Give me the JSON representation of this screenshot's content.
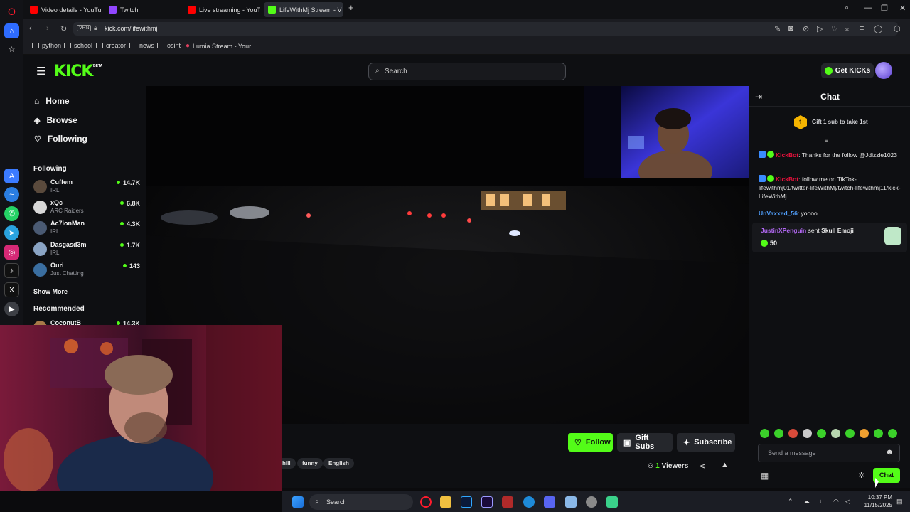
{
  "browser": {
    "tabs": [
      {
        "title": "Video details - YouTube S",
        "color": "#ff0000"
      },
      {
        "title": "Twitch",
        "color": "#9146ff"
      },
      {
        "title": "Live streaming - YouTube",
        "color": "#ff0000"
      },
      {
        "title": "LifeWithMj Stream - V",
        "color": "#53fc18"
      }
    ],
    "vpn_label": "VPN",
    "url": "kick.com/lifewithmj",
    "bookmarks": [
      "python",
      "school",
      "creator",
      "news",
      "osint",
      "Lumia Stream - Your..."
    ]
  },
  "header": {
    "logo": "KICK",
    "beta": "BETA",
    "search_placeholder": "Search",
    "get_kicks": "Get KICKs"
  },
  "sidebar": {
    "nav": [
      {
        "label": "Home",
        "icon": "home-icon"
      },
      {
        "label": "Browse",
        "icon": "compass-icon"
      },
      {
        "label": "Following",
        "icon": "heart-icon"
      }
    ],
    "following_title": "Following",
    "channels": [
      {
        "name": "Cuffem",
        "category": "IRL",
        "viewers": "14.7K",
        "color": "#5a4a3c"
      },
      {
        "name": "xQc",
        "category": "ARC Raiders",
        "viewers": "6.8K",
        "color": "#d8d8d8"
      },
      {
        "name": "Ac7ionMan",
        "category": "IRL",
        "viewers": "4.3K",
        "color": "#4a5a73"
      },
      {
        "name": "Dasgasd3m",
        "category": "IRL",
        "viewers": "1.7K",
        "color": "#8aa4c4"
      },
      {
        "name": "Ouri",
        "category": "Just Chatting",
        "viewers": "143",
        "color": "#3a6ea0"
      }
    ],
    "show_more": "Show More",
    "recommended_title": "Recommended",
    "recommended": [
      {
        "name": "CoconutB",
        "viewers": "14.3K"
      }
    ]
  },
  "stream": {
    "follow_label": "Follow",
    "gift_subs_label": "Gift Subs",
    "subscribe_label": "Subscribe",
    "tags": [
      "hill",
      "funny",
      "English"
    ],
    "viewers_count": "1",
    "viewers_label": "Viewers"
  },
  "chat": {
    "title": "Chat",
    "gift_rank": "1",
    "gift_prompt": "Gift 1 sub to take 1st",
    "messages": [
      {
        "user": "KickBot",
        "text": ": Thanks for the follow @Jdizzle1023"
      },
      {
        "user": "KickBot",
        "text": ": follow me on TikTok-lifewithmj01/twitter-lifeWithMj/twitch-lifewithmj11/kick-LifeWithMj"
      },
      {
        "user": "UnVaxxed_56",
        "text": ": yoooo"
      }
    ],
    "gift_event": {
      "user": "JustinXPenguin",
      "action": "sent",
      "item": "Skull Emoji",
      "amount": "50"
    },
    "input_placeholder": "Send a message",
    "send_label": "Chat"
  },
  "taskbar": {
    "search_label": "Search",
    "time": "10:37 PM",
    "date": "11/15/2025"
  },
  "colors": {
    "kick_green": "#53fc18",
    "chat_red": "#e9113c"
  }
}
